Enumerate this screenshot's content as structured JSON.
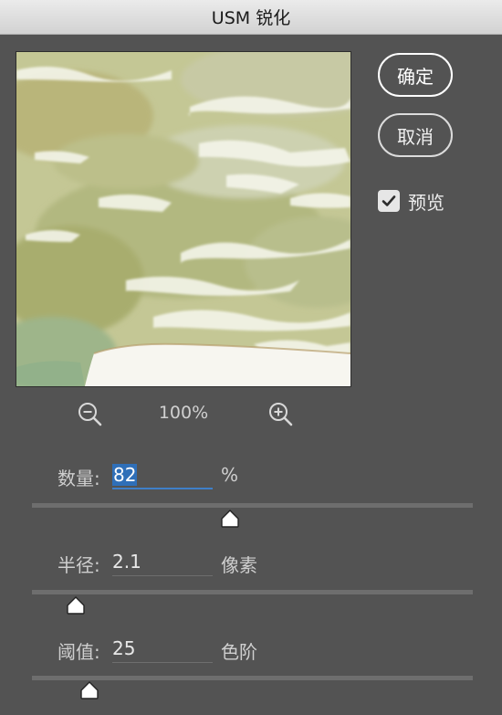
{
  "window": {
    "title": "USM 锐化"
  },
  "buttons": {
    "ok": "确定",
    "cancel": "取消"
  },
  "preview_toggle": {
    "label": "预览",
    "checked": true
  },
  "zoom": {
    "level": "100%"
  },
  "fields": [
    {
      "label": "数量:",
      "value": "82",
      "unit": "%",
      "slider_fraction": 0.45
    },
    {
      "label": "半径:",
      "value": "2.1",
      "unit": "像素",
      "slider_fraction": 0.1
    },
    {
      "label": "阈值:",
      "value": "25",
      "unit": "色阶",
      "slider_fraction": 0.13
    }
  ],
  "colors": {
    "panel": "#535353",
    "accent": "#2f6fb8"
  },
  "icons": [
    "zoom-out-icon",
    "zoom-in-icon",
    "checkmark-icon",
    "slider-thumb-icon"
  ]
}
